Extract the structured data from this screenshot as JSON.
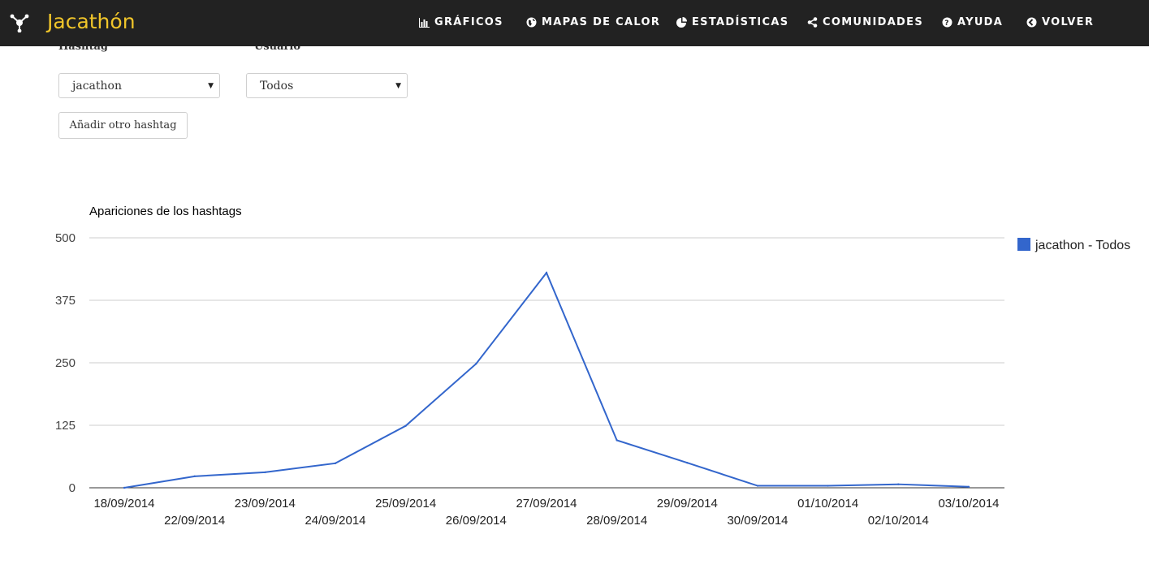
{
  "navbar": {
    "brand": "Jacathón",
    "items": [
      {
        "label": "GRÁFICOS",
        "icon": "bar-chart-icon"
      },
      {
        "label": "MAPAS DE CALOR",
        "icon": "globe-icon"
      },
      {
        "label": "ESTADÍSTICAS",
        "icon": "pie-chart-icon"
      },
      {
        "label": "COMUNIDADES",
        "icon": "share-icon"
      },
      {
        "label": "AYUDA",
        "icon": "question-icon"
      },
      {
        "label": "VOLVER",
        "icon": "back-arrow-icon"
      }
    ]
  },
  "filters": {
    "hashtag_label": "Hashtag",
    "usuario_label": "Usuario",
    "hashtag_value": "jacathon",
    "usuario_value": "Todos",
    "add_button": "Añadir otro hashtag"
  },
  "chart_data": {
    "type": "line",
    "title": "Apariciones de los hashtags",
    "xlabel": "",
    "ylabel": "",
    "ylim": [
      0,
      500
    ],
    "yticks": [
      "0",
      "125",
      "250",
      "375",
      "500"
    ],
    "x": [
      "18/09/2014",
      "22/09/2014",
      "23/09/2014",
      "24/09/2014",
      "25/09/2014",
      "26/09/2014",
      "27/09/2014",
      "28/09/2014",
      "29/09/2014",
      "30/09/2014",
      "01/10/2014",
      "02/10/2014",
      "03/10/2014"
    ],
    "series": [
      {
        "name": "jacathon - Todos",
        "color": "#3366cc",
        "values": [
          0,
          23,
          31,
          49,
          124,
          248,
          430,
          95,
          50,
          4,
          4,
          7,
          2
        ]
      }
    ],
    "grid": true,
    "legend": "right"
  }
}
